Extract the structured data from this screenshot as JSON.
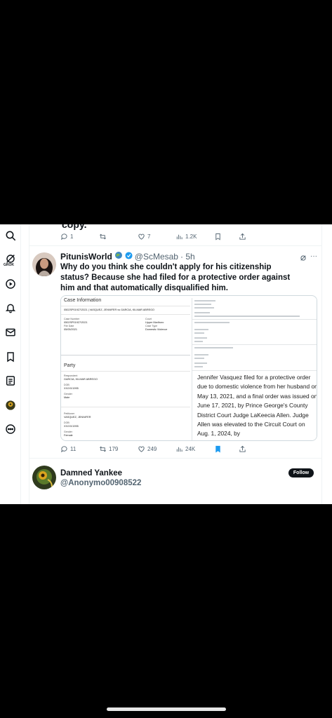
{
  "prev_tweet": {
    "cut_text": "copy.",
    "actions": {
      "replies": "1",
      "retweets": "",
      "likes": "7",
      "views": "1.2K"
    }
  },
  "sidebar": {
    "grok_label": "GROK",
    "items": [
      {
        "icon": "search-icon"
      },
      {
        "icon": "grok-icon"
      },
      {
        "icon": "video-icon"
      },
      {
        "icon": "bell-icon"
      },
      {
        "icon": "mail-icon"
      },
      {
        "icon": "bookmark-icon"
      },
      {
        "icon": "list-icon"
      },
      {
        "icon": "profile-avatar"
      },
      {
        "icon": "more-circle-icon"
      }
    ]
  },
  "tweet": {
    "author_name": "PitunisWorld",
    "handle": "@ScMesab",
    "time": "· 5h",
    "text": "Why do you think she couldn't apply for his citizenship status? Because she had filed for a protective order against him and that automatically disqualified him.",
    "actions": {
      "replies": "11",
      "retweets": "179",
      "likes": "249",
      "views": "24K"
    },
    "media": {
      "case_information_title": "Case Information",
      "case_line": "0502SP01927/2021 | VASQUEZ, JENNIFER vs GARCIA, KILMAR ABREGO",
      "case_number_label": "Case Number",
      "case_number": "0502SP01927/2021",
      "court_label": "Court",
      "court": "Upper Marlboro",
      "file_date_label": "File Date",
      "file_date": "05/05/2021",
      "case_type_label": "Case Type",
      "case_type": "Domestic Violence",
      "party_title": "Party",
      "respondent_label": "Respondent",
      "respondent": "GARCIA, KILMAR ABREGO",
      "dob_label": "DOB",
      "dob": "XX/XX/1995",
      "gender_label": "Gender",
      "respondent_gender": "Male",
      "petitioner_label": "Petitioner",
      "petitioner": "VASQUEZ, JENNIFER",
      "petitioner_dob": "XX/XX/1995",
      "petitioner_gender": "Female",
      "overlay_text": "Jennifer Vasquez filed for a protective order due to domestic violence from her husband on May 13, 2021, and a final order was issued on June 17, 2021, by Prince George's County District Court Judge LaKeecia Allen. Judge Allen was elevated to the Circuit Court on Aug. 1, 2024, by"
    }
  },
  "next_user": {
    "name": "Damned Yankee",
    "handle": "@Anonymo00908522",
    "follow_label": "Follow"
  },
  "colors": {
    "verified_blue": "#1d9bf0",
    "text_primary": "#0f1419",
    "text_secondary": "#536471"
  }
}
